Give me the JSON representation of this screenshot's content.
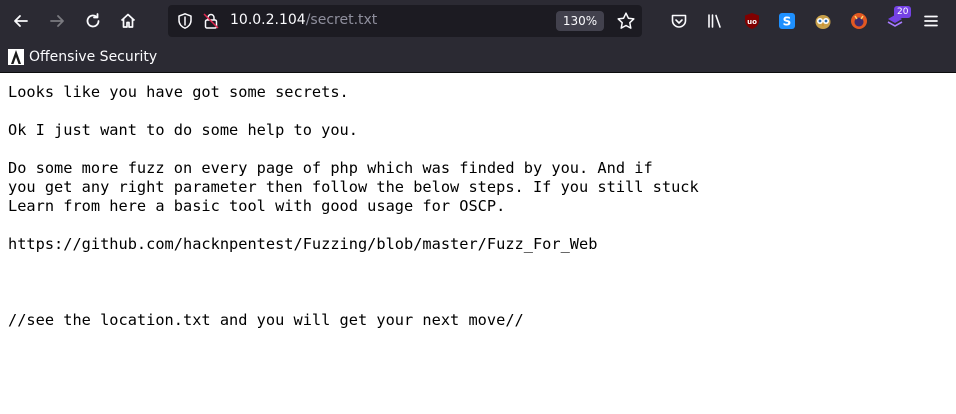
{
  "browser": {
    "url_host": "10.0.2.104",
    "url_path": "/secret.txt",
    "zoom_label": "130%",
    "extension_badge_count": "20",
    "icons": [
      "back-icon",
      "forward-icon",
      "reload-icon",
      "home-icon",
      "shield-icon",
      "lock-icon",
      "star-icon",
      "pocket-icon",
      "library-icon",
      "ublock-icon",
      "extension-s-icon",
      "extension-owl-icon",
      "extension-fox-icon",
      "extension-stack-icon",
      "menu-icon"
    ]
  },
  "bookmarks": {
    "items": [
      {
        "label": "Offensive Security",
        "icon": "offsec-icon"
      }
    ]
  },
  "page": {
    "lines": [
      "Looks like you have got some secrets.",
      "",
      "Ok I just want to do some help to you.",
      "",
      "Do some more fuzz on every page of php which was finded by you. And if",
      "you get any right parameter then follow the below steps. If you still stuck",
      "Learn from here a basic tool with good usage for OSCP.",
      "",
      "https://github.com/hacknpentest/Fuzzing/blob/master/Fuzz_For_Web",
      "",
      "",
      "",
      "//see the location.txt and you will get your next move//"
    ]
  },
  "colors": {
    "toolbar_bg": "#2b2a33",
    "urlbar_bg": "#1c1b22",
    "badge_bg": "#7542e5"
  }
}
